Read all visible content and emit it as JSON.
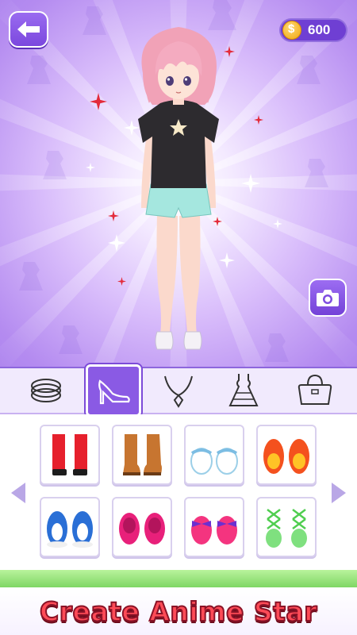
{
  "header": {
    "back_icon": "arrow-left-icon",
    "coins": {
      "icon": "coin-icon",
      "symbol": "$",
      "amount": "600"
    }
  },
  "stage": {
    "camera_icon": "camera-icon",
    "character": "anime-girl-pink-hair",
    "colors": {
      "accent": "#8a5ae4",
      "background": "#b48bf0"
    }
  },
  "categories": [
    {
      "name": "bracelets",
      "icon": "bracelet-icon",
      "active": false
    },
    {
      "name": "shoes",
      "icon": "high-heel-icon",
      "active": true
    },
    {
      "name": "necklaces",
      "icon": "necklace-icon",
      "active": false
    },
    {
      "name": "dresses",
      "icon": "dress-icon",
      "active": false
    },
    {
      "name": "bags",
      "icon": "handbag-icon",
      "active": false
    }
  ],
  "items": [
    {
      "icon": "red-boots-icon"
    },
    {
      "icon": "brown-boots-icon"
    },
    {
      "icon": "white-blue-clogs-icon"
    },
    {
      "icon": "orange-flats-icon"
    },
    {
      "icon": "blue-sneakers-icon"
    },
    {
      "icon": "pink-flats-icon"
    },
    {
      "icon": "pink-bow-shoes-icon"
    },
    {
      "icon": "green-lace-sandals-icon"
    }
  ],
  "banner": {
    "title": "Create Anime Star"
  }
}
